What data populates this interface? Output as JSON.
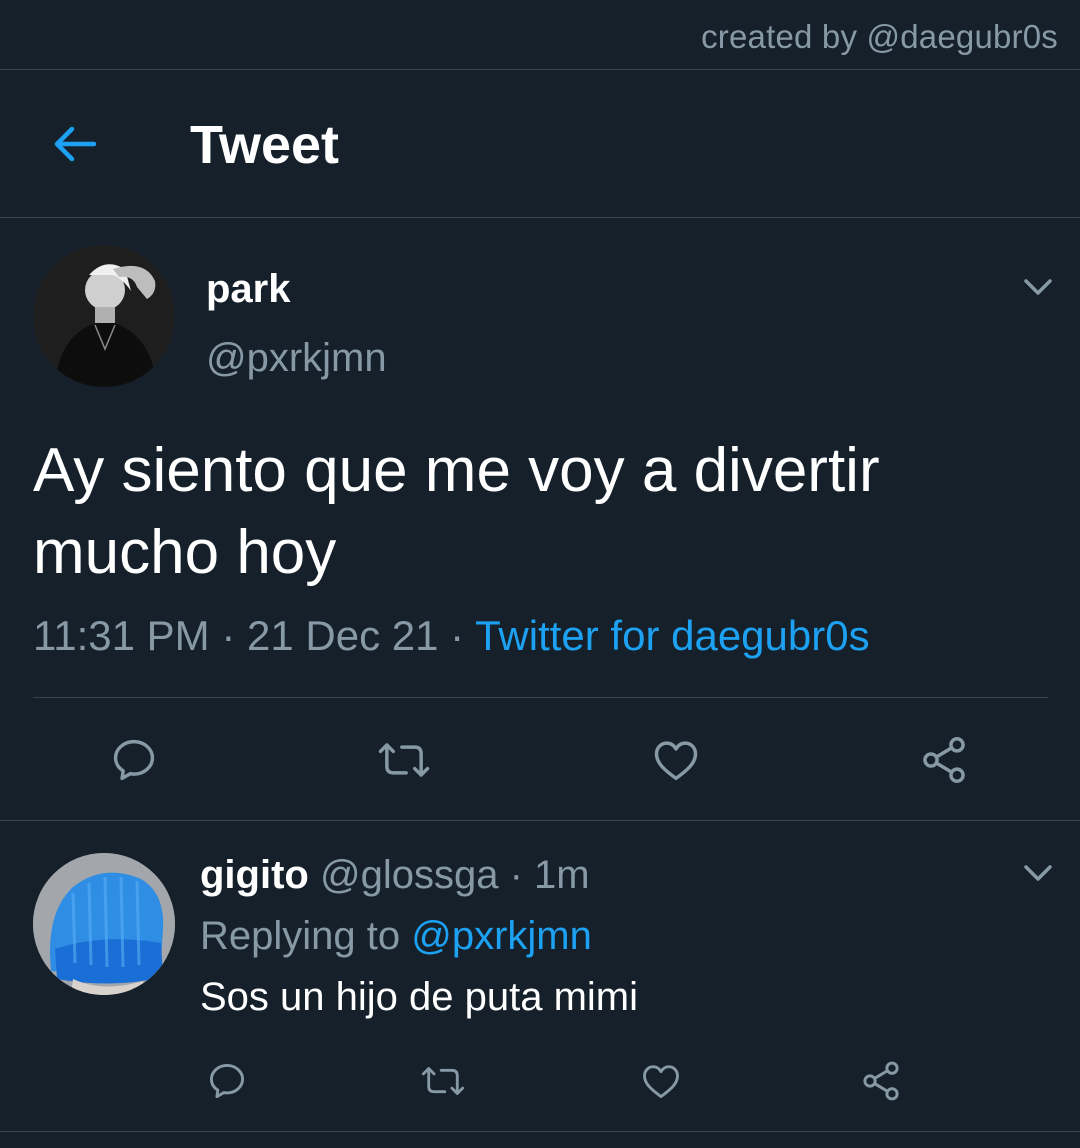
{
  "credit": "created by @daegubr0s",
  "header": {
    "title": "Tweet",
    "back_icon": "arrow-left-icon"
  },
  "tweet": {
    "display_name": "park",
    "handle": "@pxrkjmn",
    "text": "Ay siento que me voy a divertir mucho hoy",
    "time": "11:31 PM",
    "date": "21 Dec 21",
    "separator": "·",
    "source": "Twitter for daegubr0s",
    "actions": [
      "reply-icon",
      "retweet-icon",
      "like-icon",
      "share-icon"
    ]
  },
  "reply": {
    "display_name": "gigito",
    "handle": "@glossga",
    "separator": "·",
    "time": "1m",
    "replying_label": "Replying to",
    "replying_to": "@pxrkjmn",
    "text": "Sos un hijo de puta mimi",
    "actions": [
      "reply-icon",
      "retweet-icon",
      "like-icon",
      "share-icon"
    ]
  },
  "colors": {
    "background": "#15202b",
    "divider": "#38444d",
    "secondary_text": "#8899a6",
    "accent": "#1da1f2",
    "primary_text": "#ffffff"
  }
}
